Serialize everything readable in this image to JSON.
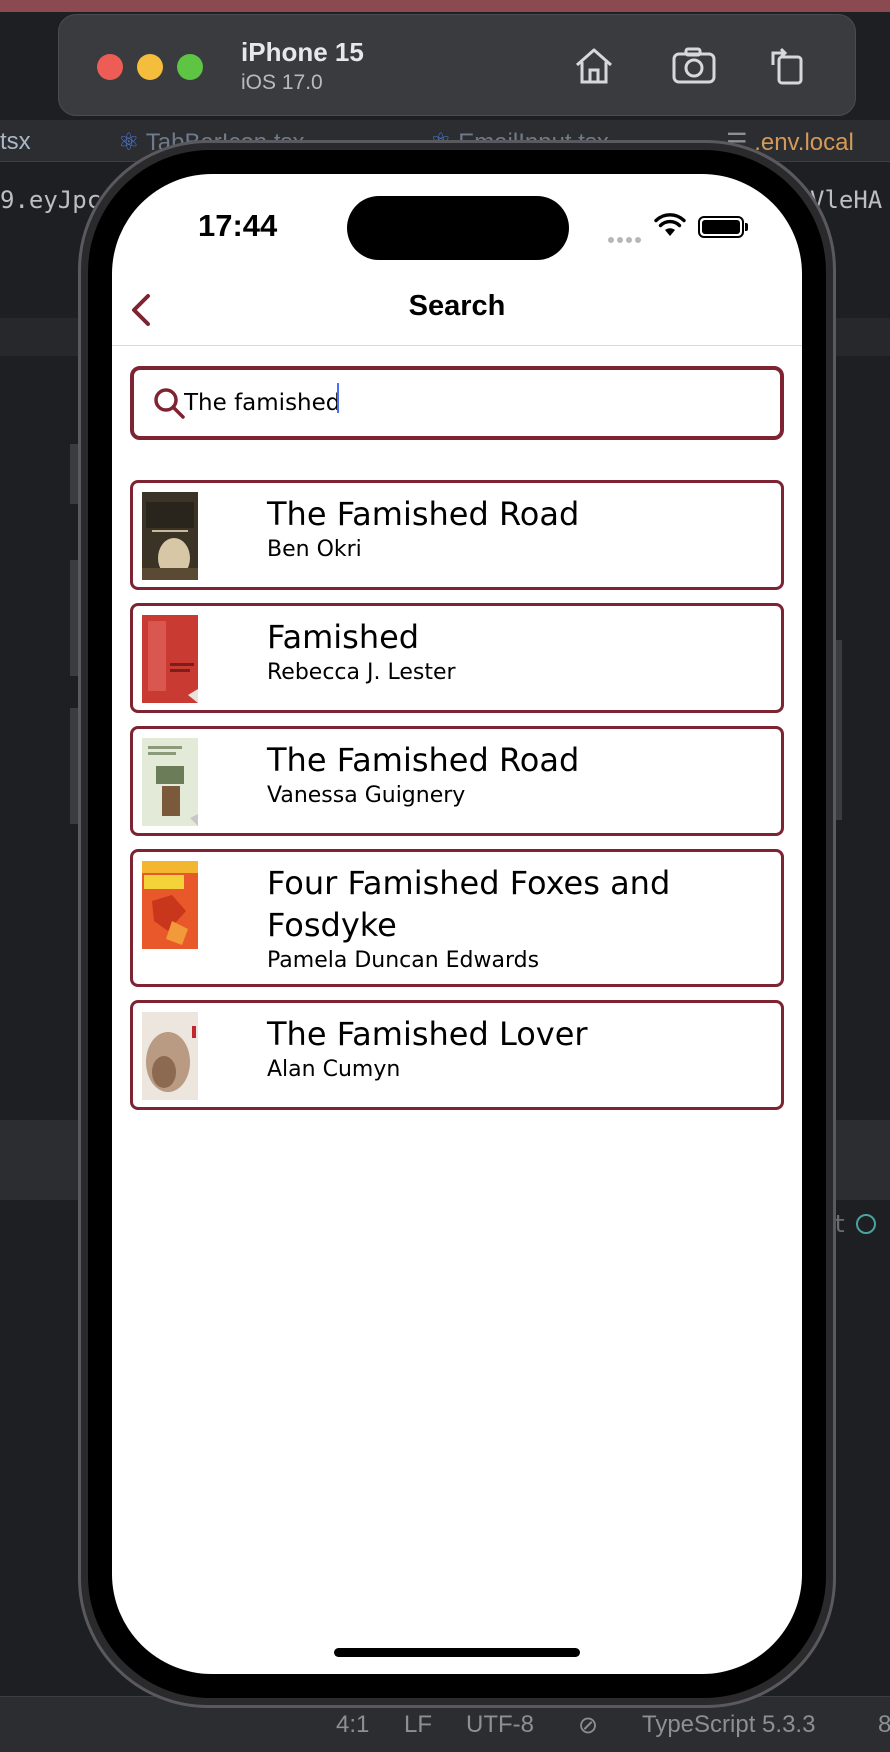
{
  "ide": {
    "tabs": [
      "tsx",
      "TabBarIcon.tsx",
      "EmailInput.tsx",
      ".env.local"
    ],
    "code_left": "9.eyJpc",
    "code_right": "VleHA",
    "status_right_fragment": "t",
    "status": {
      "position": "4:1",
      "line_ending": "LF",
      "encoding": "UTF-8",
      "language": "TypeScript 5.3.3",
      "extra": "8"
    }
  },
  "simulator": {
    "device_name": "iPhone 15",
    "os_version": "iOS 17.0",
    "buttons": [
      "home-icon",
      "screenshot-icon",
      "rotate-icon"
    ]
  },
  "status_bar": {
    "time": "17:44"
  },
  "nav": {
    "title": "Search"
  },
  "search": {
    "value": "The famished",
    "placeholder": ""
  },
  "results": [
    {
      "title": "The Famished Road",
      "author": "Ben Okri"
    },
    {
      "title": "Famished",
      "author": "Rebecca J. Lester"
    },
    {
      "title": "The Famished Road",
      "author": "Vanessa Guignery"
    },
    {
      "title": "Four Famished Foxes and Fosdyke",
      "author": "Pamela Duncan Edwards"
    },
    {
      "title": "The Famished Lover",
      "author": "Alan Cumyn"
    }
  ],
  "colors": {
    "accent": "#7d2332",
    "ide_background": "#1e1f22"
  }
}
